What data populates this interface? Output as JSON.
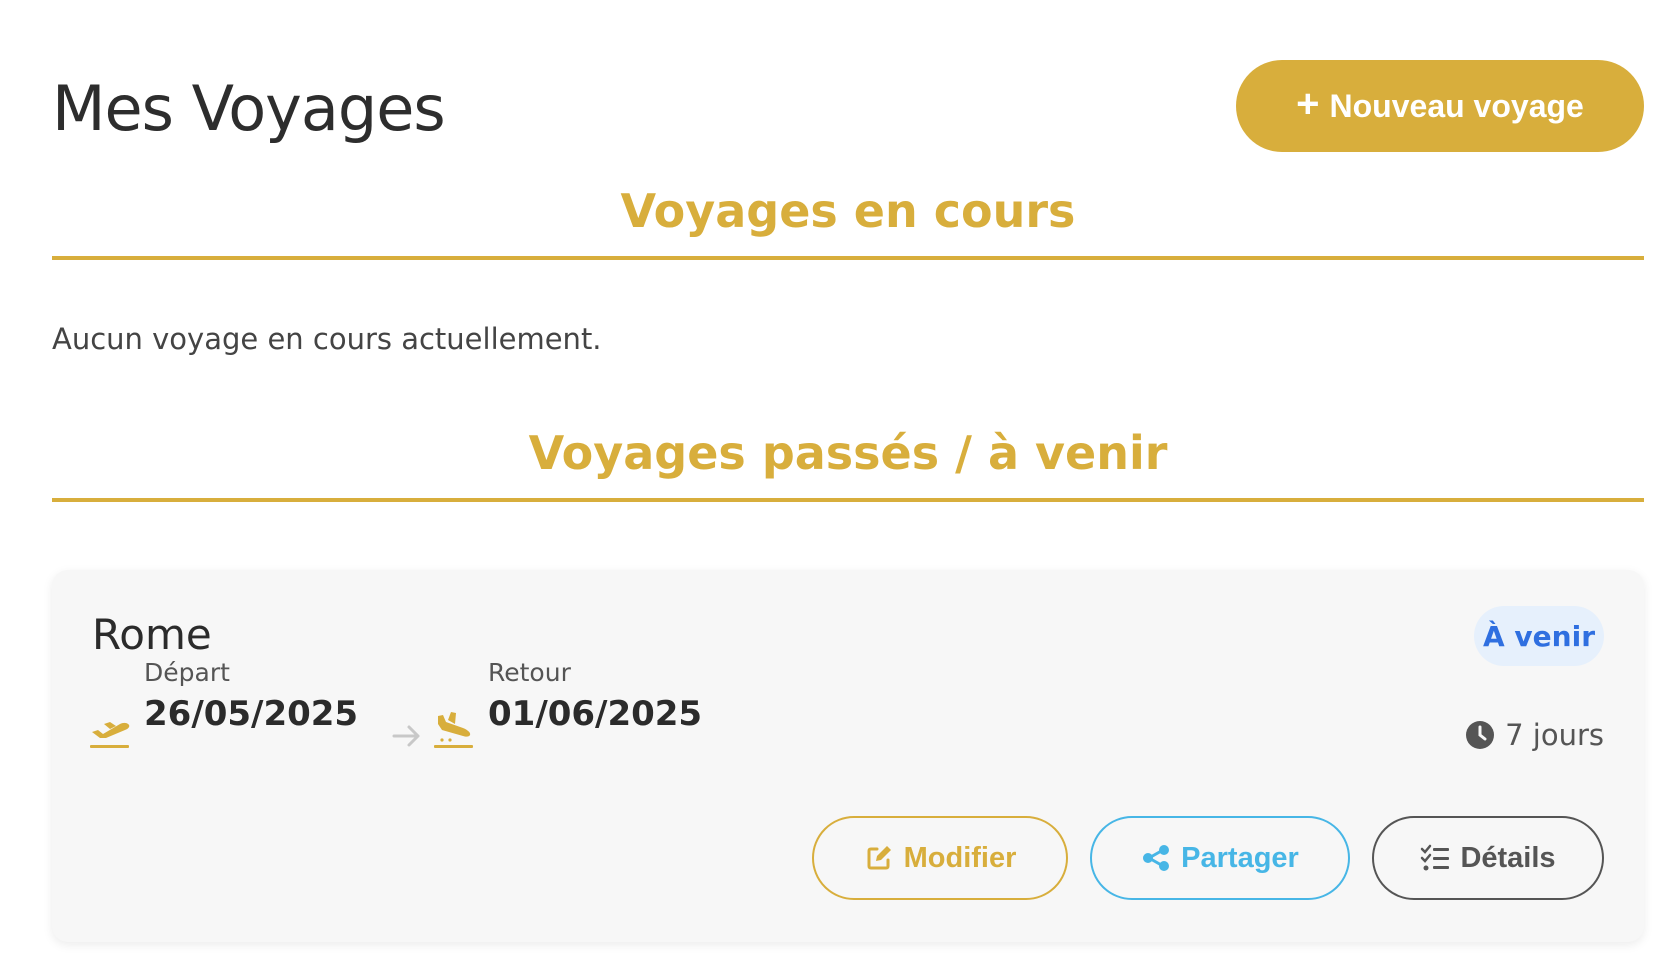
{
  "header": {
    "title": "Mes Voyages",
    "new_trip_plus": "+",
    "new_trip_label": "Nouveau voyage"
  },
  "sections": {
    "current": {
      "title": "Voyages en cours",
      "empty_message": "Aucun voyage en cours actuellement."
    },
    "past_upcoming": {
      "title": "Voyages passés / à venir"
    }
  },
  "trips": [
    {
      "name": "Rome",
      "status": "À venir",
      "departure_label": "Départ",
      "departure_date": "26/05/2025",
      "return_label": "Retour",
      "return_date": "01/06/2025",
      "duration": "7 jours",
      "actions": {
        "edit": "Modifier",
        "share": "Partager",
        "details": "Détails"
      }
    }
  ],
  "icons": {
    "departure": "plane-departure-icon",
    "arrival": "plane-arrival-icon",
    "arrow": "arrow-right-icon",
    "duration": "clock-icon",
    "edit": "edit-icon",
    "share": "share-icon",
    "details": "list-check-icon"
  },
  "colors": {
    "accent": "#d8ae3c",
    "status_badge_bg": "#e6f0fc",
    "status_badge_text": "#2f6fe0",
    "share": "#47b6e6",
    "details": "#555555",
    "card_bg": "#f7f7f7"
  }
}
